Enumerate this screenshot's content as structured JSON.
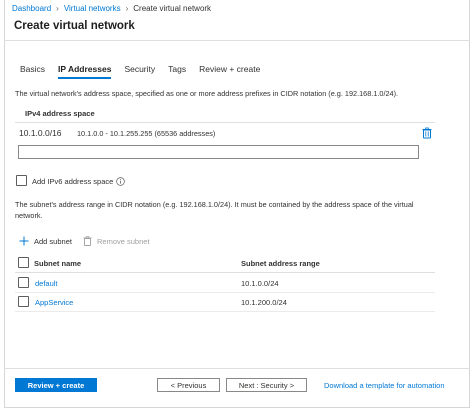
{
  "breadcrumb": {
    "items": [
      {
        "label": "Dashboard"
      },
      {
        "label": "Virtual networks"
      },
      {
        "label": "Create virtual network"
      }
    ]
  },
  "page": {
    "title": "Create virtual network"
  },
  "tabs": [
    {
      "label": "Basics",
      "active": false
    },
    {
      "label": "IP Addresses",
      "active": true
    },
    {
      "label": "Security",
      "active": false
    },
    {
      "label": "Tags",
      "active": false
    },
    {
      "label": "Review + create",
      "active": false
    }
  ],
  "address_space": {
    "description": "The virtual network's address space, specified as one or more address prefixes in CIDR notation (e.g. 192.168.1.0/24).",
    "column_header": "IPv4 address space",
    "rows": [
      {
        "prefix": "10.1.0.0/16",
        "range": "10.1.0.0 - 10.1.255.255 (65536 addresses)"
      }
    ],
    "new_value": "",
    "delete_icon": "trash-icon"
  },
  "ipv6": {
    "label": "Add IPv6 address space",
    "checked": false,
    "info_icon": "info-icon"
  },
  "subnets": {
    "description": "The subnet's address range in CIDR notation (e.g. 192.168.1.0/24). It must be contained by the address space of the virtual network.",
    "add_label": "Add subnet",
    "remove_label": "Remove subnet",
    "columns": [
      "Subnet name",
      "Subnet address range"
    ],
    "rows": [
      {
        "name": "default",
        "range": "10.1.0.0/24"
      },
      {
        "name": "AppService",
        "range": "10.1.200.0/24"
      }
    ]
  },
  "footer": {
    "review_create_label": "Review + create",
    "previous_label": "< Previous",
    "next_label": "Next : Security >",
    "download_link": "Download a template for automation"
  },
  "colors": {
    "accent": "#0078d4",
    "text": "#323130",
    "border": "#8a8886",
    "disabled": "#a19f9d"
  }
}
